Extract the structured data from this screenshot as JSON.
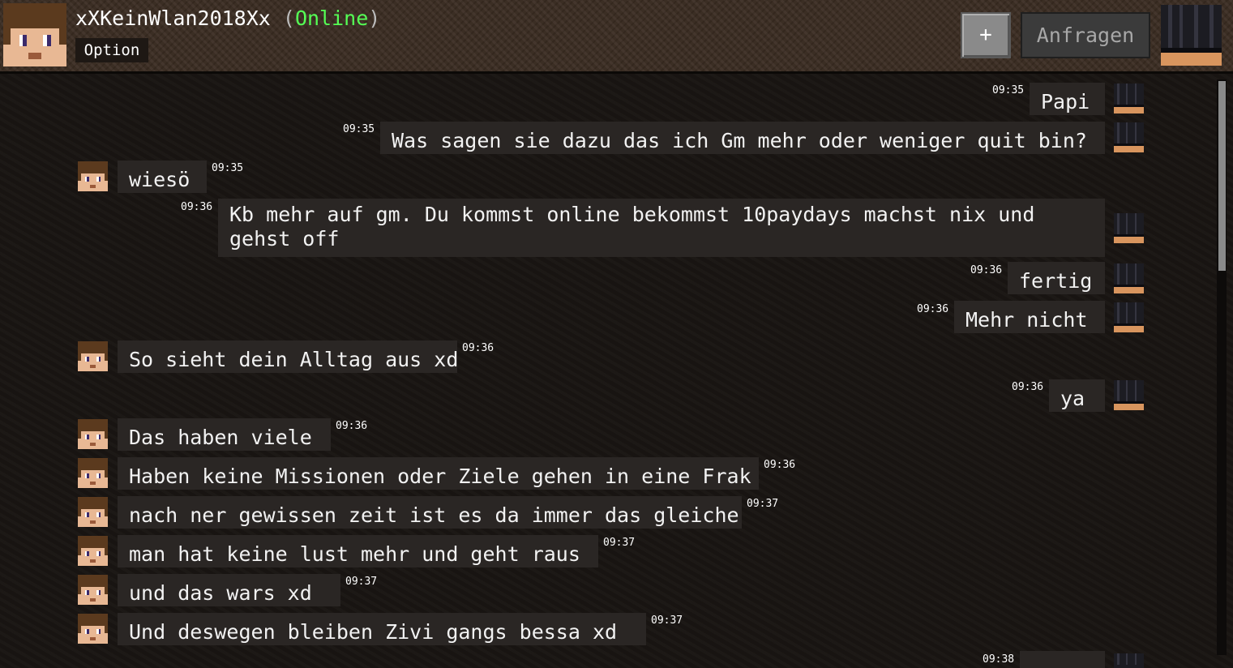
{
  "header": {
    "username": "xXKeinWlan2018Xx",
    "status_open": "(",
    "status": "Online",
    "status_close": ")",
    "option_label": "Option",
    "add_label": "+",
    "requests_label": "Anfragen"
  },
  "messages": [
    {
      "side": "right",
      "text": "Papi",
      "time": "09:35"
    },
    {
      "side": "right",
      "text": "Was sagen sie dazu das ich Gm mehr oder weniger quit bin?",
      "time": "09:35"
    },
    {
      "side": "left",
      "text": "wiesö",
      "time": "09:35"
    },
    {
      "side": "right",
      "text": "Kb mehr auf gm. Du kommst online bekommst 10paydays machst nix und gehst off",
      "time": "09:36"
    },
    {
      "side": "right",
      "text": "fertig",
      "time": "09:36"
    },
    {
      "side": "right",
      "text": "Mehr nicht",
      "time": "09:36"
    },
    {
      "side": "left",
      "text": "So sieht dein Alltag aus xd",
      "time": "09:36"
    },
    {
      "side": "right",
      "text": "ya",
      "time": "09:36"
    },
    {
      "side": "left",
      "text": "Das haben viele",
      "time": "09:36"
    },
    {
      "side": "left",
      "text": "Haben keine Missionen oder Ziele gehen in eine Frak",
      "time": "09:36"
    },
    {
      "side": "left",
      "text": "nach ner gewissen zeit ist es da immer das gleiche",
      "time": "09:37"
    },
    {
      "side": "left",
      "text": "man hat keine lust mehr und geht raus",
      "time": "09:37"
    },
    {
      "side": "left",
      "text": "und das wars xd",
      "time": "09:37"
    },
    {
      "side": "left",
      "text": "Und deswegen bleiben Zivi gangs bessa xd",
      "time": "09:37"
    },
    {
      "side": "right",
      "text": "",
      "time": "09:38"
    }
  ],
  "colors": {
    "status_online": "#55ff55",
    "bubble_bg": "#2a2624",
    "header_bg": "#3a2c22"
  },
  "icons": {
    "friend_avatar": "player-head-brown-hair-icon",
    "own_avatar": "player-head-dark-icon"
  }
}
